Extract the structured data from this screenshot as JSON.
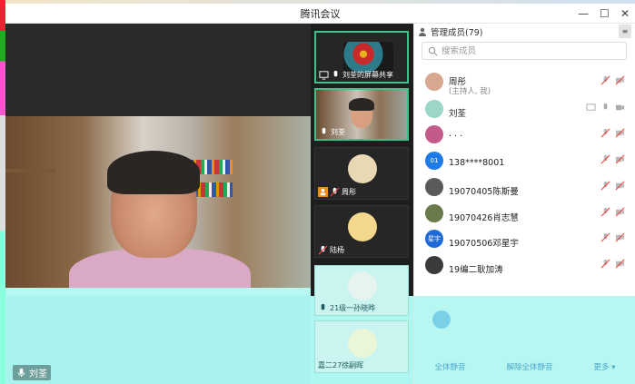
{
  "window": {
    "title": "腾讯会议",
    "minimize": "—",
    "maximize": "☐",
    "close": "✕"
  },
  "main_video": {
    "speaker_name": "刘荃"
  },
  "thumbnails": [
    {
      "label": "刘荃的屏幕共享"
    },
    {
      "label": "刘荃"
    },
    {
      "label": "周彤"
    },
    {
      "label": "陆杨"
    },
    {
      "label": "21级一孙晓晔"
    },
    {
      "label": "嘉二27徐嗣晖"
    }
  ],
  "panel": {
    "title": "管理成员(79)",
    "search_placeholder": "搜索成员",
    "toggle_label": "≡",
    "members": [
      {
        "name": "周彤",
        "sub": "(主持人, 我)",
        "avatar_text": "",
        "avatar_color": "#d8a890"
      },
      {
        "name": "刘荃",
        "sub": "",
        "avatar_text": "",
        "avatar_color": "#9bd6c9"
      },
      {
        "name": "· · ·",
        "sub": "",
        "avatar_text": "",
        "avatar_color": "#c25a8a"
      },
      {
        "name": "138****8001",
        "sub": "",
        "avatar_text": "01",
        "avatar_color": "#1e7be8"
      },
      {
        "name": "19070405陈斯曼",
        "sub": "",
        "avatar_text": "",
        "avatar_color": "#5a5a5a"
      },
      {
        "name": "19070426肖志慧",
        "sub": "",
        "avatar_text": "",
        "avatar_color": "#6a7a4a"
      },
      {
        "name": "19070506邓星宇",
        "sub": "",
        "avatar_text": "星宇",
        "avatar_color": "#1e6ad8"
      },
      {
        "name": "19编二耿加涛",
        "sub": "",
        "avatar_text": "",
        "avatar_color": "#3a3a3a"
      }
    ],
    "footer": {
      "mute_all": "全体静音",
      "unmute_all": "解除全体静音",
      "more": "更多 ▾"
    }
  },
  "colors": {
    "active_border": "#3fc28a",
    "muted_red": "#e64545",
    "overlay_teal": "#b6f7f1"
  }
}
